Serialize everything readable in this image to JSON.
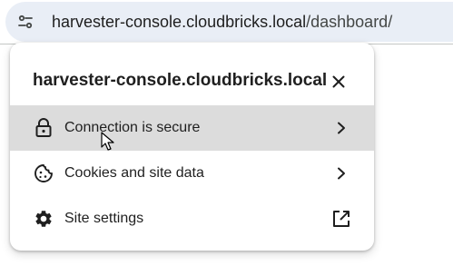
{
  "addressbar": {
    "tune_icon": "tune-icon",
    "url_host": "harvester-console.cloudbricks.local",
    "url_path": "/dashboard/"
  },
  "site_info_popup": {
    "title": "harvester-console.cloudbricks.local",
    "close_icon": "close-icon",
    "items": [
      {
        "label": "Connection is secure",
        "icon": "lock-icon",
        "trailing": "chevron-right-icon",
        "hovered": true
      },
      {
        "label": "Cookies and site data",
        "icon": "cookie-icon",
        "trailing": "chevron-right-icon",
        "hovered": false
      },
      {
        "label": "Site settings",
        "icon": "gear-icon",
        "trailing": "open-in-new-icon",
        "hovered": false
      }
    ]
  },
  "colors": {
    "omnibox_bg": "#e9eef6",
    "hover_row_bg": "#dcdcdc",
    "text": "#1f1f1f",
    "url_path": "#444746"
  }
}
